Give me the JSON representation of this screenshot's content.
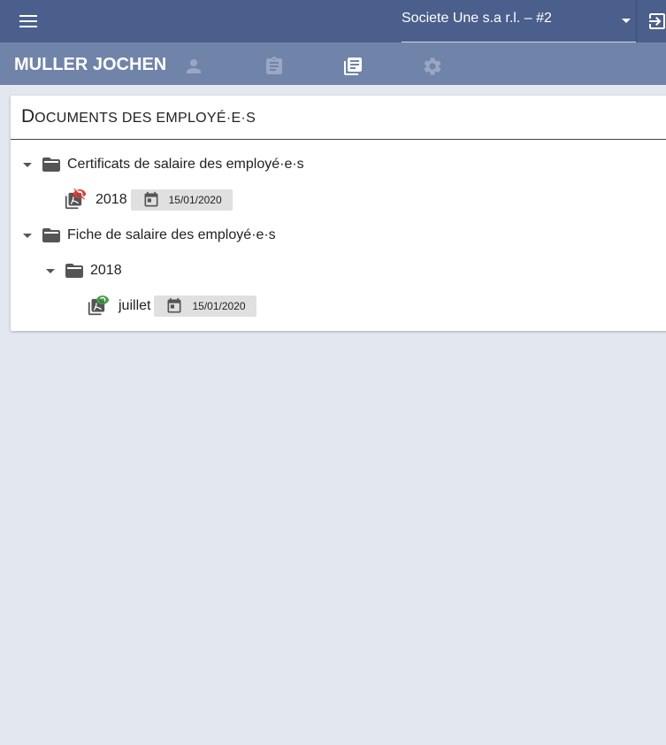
{
  "topbar": {
    "menu_icon": "menu-icon",
    "company": "Societe Une s.a r.l. – #2",
    "logout_icon": "logout-icon"
  },
  "subbar": {
    "user_name": "MULLER JOCHEN",
    "nav": [
      {
        "icon": "person-icon",
        "active": false
      },
      {
        "icon": "clipboard-icon",
        "active": false
      },
      {
        "icon": "documents-icon",
        "active": true
      },
      {
        "icon": "settings-icon",
        "active": false
      }
    ]
  },
  "card": {
    "title_initial": "D",
    "title_rest": "ocuments des employé·e·s"
  },
  "tree": {
    "folder1": {
      "label": "Certificats de salaire des employé·e·s",
      "files": [
        {
          "label": "2018",
          "date": "15/01/2020",
          "status": "unread"
        }
      ]
    },
    "folder2": {
      "label": "Fiche de salaire des employé·e·s",
      "subfolder": {
        "label": "2018",
        "files": [
          {
            "label": "juillet",
            "date": "15/01/2020",
            "status": "read"
          }
        ]
      }
    }
  },
  "colors": {
    "topbar": "#4a5f8c",
    "subbar": "#7083a9",
    "background": "#e3e7ef",
    "unread_eye": "#e53935",
    "read_eye": "#43a047"
  }
}
